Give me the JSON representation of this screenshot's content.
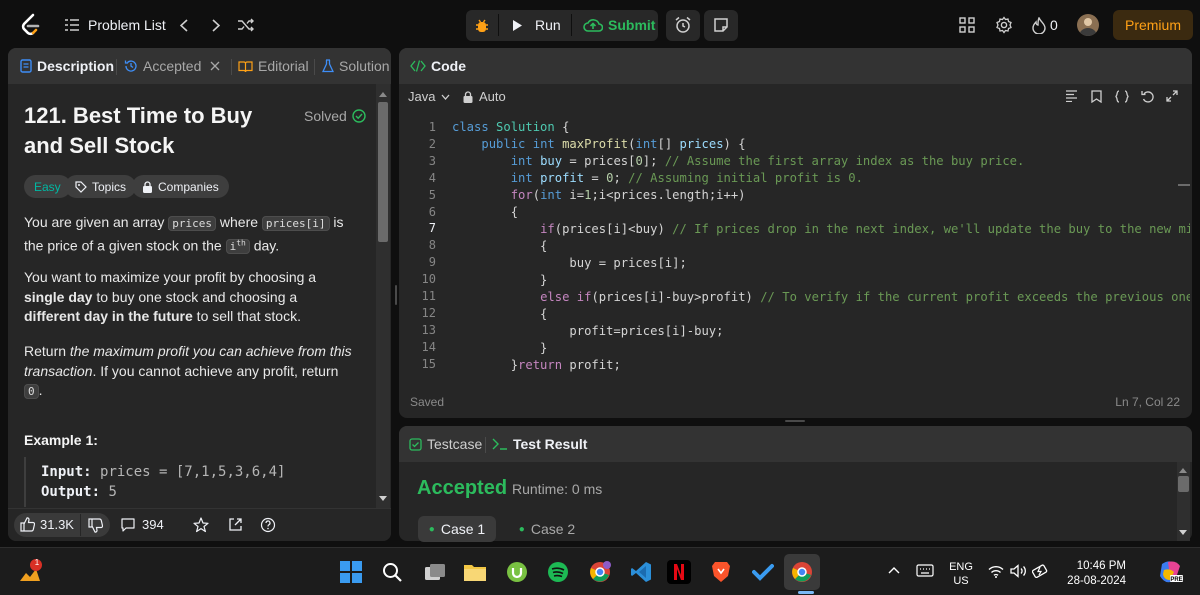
{
  "nav": {
    "problem_list": "Problem List",
    "run": "Run",
    "submit": "Submit",
    "streak_count": "0",
    "premium": "Premium"
  },
  "left_panel": {
    "tabs": [
      "Description",
      "Accepted",
      "Editorial",
      "Solution"
    ],
    "title": "121. Best Time to Buy and Sell Stock",
    "status": "Solved",
    "tags": [
      "Easy",
      "Topics",
      "Companies"
    ],
    "para1": {
      "t1": "You are given an array ",
      "c1": "prices",
      "t2": " where ",
      "c2": "prices[i]",
      "t3": " is the price of a given stock on the ",
      "c3": "i",
      "sup": "th",
      "t4": " day."
    },
    "para2": {
      "t1": "You want to maximize your profit by choosing a ",
      "b1": "single day",
      "t2": " to buy one stock and choosing a ",
      "b2": "different day in the future",
      "t3": " to sell that stock."
    },
    "para3": {
      "t1": "Return ",
      "i1": "the maximum profit you can achieve from this transaction",
      "t2": ". If you cannot achieve any profit, return ",
      "c1": "0",
      "t3": "."
    },
    "example_heading": "Example 1:",
    "example": {
      "input_label": "Input:",
      "input_value": "prices = [7,1,5,3,6,4]",
      "output_label": "Output:",
      "output_value": "5"
    },
    "footer": {
      "likes": "31.3K",
      "comments": "394"
    }
  },
  "code_panel": {
    "title": "Code",
    "language": "Java",
    "mode": "Auto",
    "status": "Saved",
    "cursor": "Ln 7, Col 22",
    "line_numbers": [
      "1",
      "2",
      "3",
      "4",
      "5",
      "6",
      "7",
      "8",
      "9",
      "10",
      "11",
      "12",
      "13",
      "14",
      "15"
    ]
  },
  "test_panel": {
    "tab_testcase": "Testcase",
    "tab_result": "Test Result",
    "result": "Accepted",
    "runtime": "Runtime: 0 ms",
    "cases": [
      "Case 1",
      "Case 2"
    ]
  },
  "taskbar": {
    "notification_badge": "1",
    "language": "ENG",
    "region": "US",
    "time": "10:46 PM",
    "date": "28-08-2024"
  },
  "colors": {
    "accent_orange": "#ffa116",
    "accepted_green": "#2cbb5d",
    "easy_teal": "#00b8a3",
    "panel_bg": "#262626",
    "header_bg": "#333333",
    "page_bg": "#0f0f0f"
  }
}
